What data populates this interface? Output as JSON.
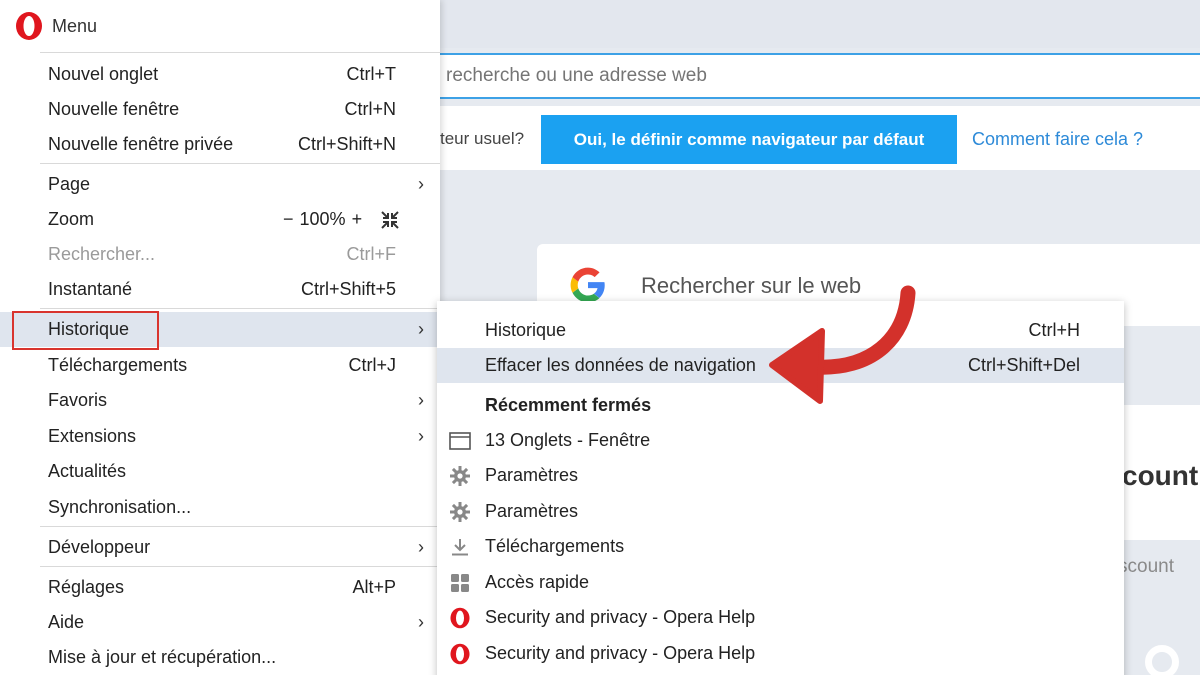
{
  "background": {
    "address_placeholder": "recherche ou une adresse web",
    "default_question": "teur usuel?",
    "default_button": "Oui, le définir comme navigateur par défaut",
    "default_link": "Comment faire cela ?",
    "search_placeholder": "Rechercher sur le web",
    "card_text": "count",
    "account_text": "scount"
  },
  "menu": {
    "title": "Menu",
    "items": [
      {
        "label": "Nouvel onglet",
        "shortcut": "Ctrl+T"
      },
      {
        "label": "Nouvelle fenêtre",
        "shortcut": "Ctrl+N"
      },
      {
        "label": "Nouvelle fenêtre privée",
        "shortcut": "Ctrl+Shift+N"
      },
      {
        "label": "Page",
        "shortcut": ""
      },
      {
        "label": "Zoom",
        "shortcut": ""
      },
      {
        "label": "Rechercher...",
        "shortcut": "Ctrl+F"
      },
      {
        "label": "Instantané",
        "shortcut": "Ctrl+Shift+5"
      },
      {
        "label": "Historique",
        "shortcut": ""
      },
      {
        "label": "Téléchargements",
        "shortcut": "Ctrl+J"
      },
      {
        "label": "Favoris",
        "shortcut": ""
      },
      {
        "label": "Extensions",
        "shortcut": ""
      },
      {
        "label": "Actualités",
        "shortcut": ""
      },
      {
        "label": "Synchronisation...",
        "shortcut": ""
      },
      {
        "label": "Développeur",
        "shortcut": ""
      },
      {
        "label": "Réglages",
        "shortcut": "Alt+P"
      },
      {
        "label": "Aide",
        "shortcut": ""
      },
      {
        "label": "Mise à jour et récupération...",
        "shortcut": ""
      }
    ],
    "zoom": {
      "minus": "−",
      "value": "100%",
      "plus": "+"
    },
    "submenu_arrow": "›"
  },
  "submenu": {
    "items": [
      {
        "label": "Historique",
        "shortcut": "Ctrl+H"
      },
      {
        "label": "Effacer les données de navigation",
        "shortcut": "Ctrl+Shift+Del"
      }
    ],
    "section_title": "Récemment fermés",
    "recent": [
      {
        "label": "13 Onglets - Fenêtre",
        "icon": "window-icon"
      },
      {
        "label": "Paramètres",
        "icon": "gear-icon"
      },
      {
        "label": "Paramètres",
        "icon": "gear-icon"
      },
      {
        "label": "Téléchargements",
        "icon": "download-icon"
      },
      {
        "label": "Accès rapide",
        "icon": "speed-dial-icon"
      },
      {
        "label": "Security and privacy - Opera Help",
        "icon": "opera-icon"
      },
      {
        "label": "Security and privacy - Opera Help",
        "icon": "opera-icon"
      }
    ]
  },
  "colors": {
    "accent_blue": "#1ba1f1",
    "link_blue": "#2d8ad8",
    "highlight_red": "#d9342e",
    "opera_red": "#e0161e",
    "hover_bg": "#dfe5ee"
  }
}
